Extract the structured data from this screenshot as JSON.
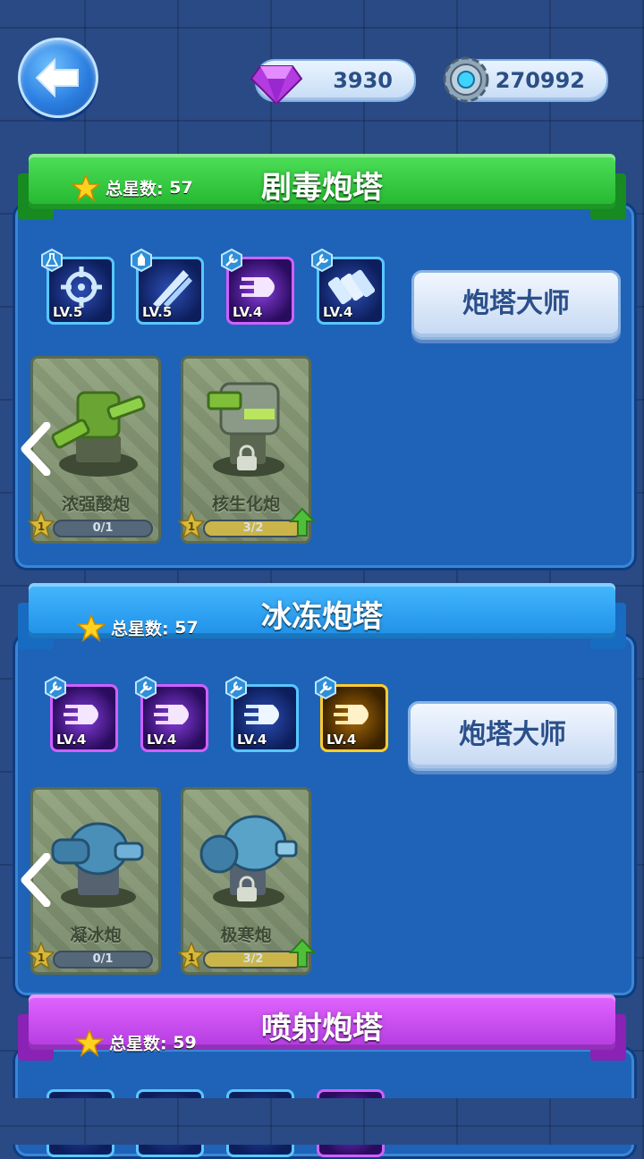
{
  "currencies": {
    "gems": "3930",
    "gears": "270992",
    "gem_icon": "gem-icon",
    "gear_icon": "gear-icon"
  },
  "stars_label": "总星数:",
  "master_label": "炮塔大师",
  "sections": [
    {
      "title": "剧毒炮塔",
      "stars": "57",
      "color": "#2fc63a",
      "skills": [
        {
          "level": "LV.5",
          "icon": "crosshair-icon",
          "badge": "flask-icon"
        },
        {
          "level": "LV.5",
          "icon": "missile-icon",
          "badge": "rocket-icon"
        },
        {
          "level": "LV.4",
          "icon": "bullet-icon",
          "badge": "wrench-icon"
        },
        {
          "level": "LV.4",
          "icon": "ammo-icon",
          "badge": "wrench-icon"
        }
      ],
      "towers": [
        {
          "name": "浓强酸炮",
          "progress": "0/1",
          "fill": 0,
          "star": "1",
          "locked": false
        },
        {
          "name": "核生化炮",
          "progress": "3/2",
          "fill": 1,
          "star": "1",
          "locked": true
        }
      ]
    },
    {
      "title": "冰冻炮塔",
      "stars": "57",
      "color": "#2e9ff0",
      "skills": [
        {
          "level": "LV.4",
          "icon": "bullet-icon",
          "badge": "wrench-icon"
        },
        {
          "level": "LV.4",
          "icon": "bullet-icon",
          "badge": "wrench-icon"
        },
        {
          "level": "LV.4",
          "icon": "bullet-icon",
          "badge": "wrench-icon"
        },
        {
          "level": "LV.4",
          "icon": "bullet-icon",
          "badge": "wrench-icon"
        }
      ],
      "towers": [
        {
          "name": "凝冰炮",
          "progress": "0/1",
          "fill": 0,
          "star": "1",
          "locked": false
        },
        {
          "name": "极寒炮",
          "progress": "3/2",
          "fill": 1,
          "star": "1",
          "locked": true
        }
      ]
    },
    {
      "title": "喷射炮塔",
      "stars": "59",
      "color": "#c445ea"
    }
  ]
}
